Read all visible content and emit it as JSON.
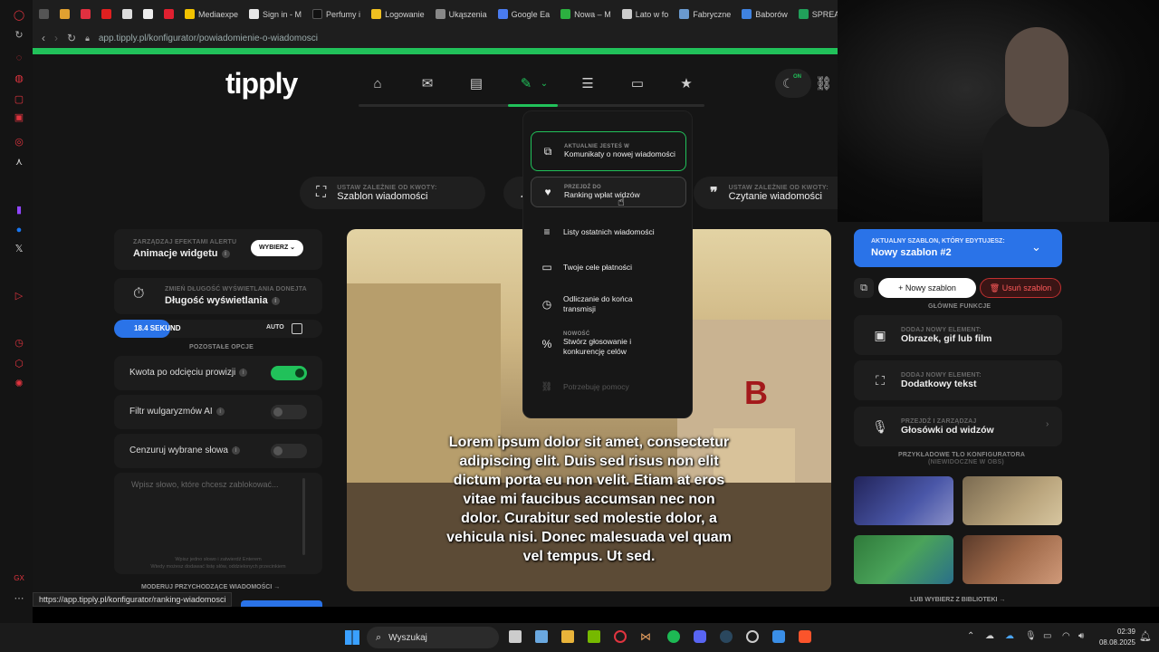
{
  "browser": {
    "bookmarks": [
      {
        "label": "Mediaexpe",
        "color": "#f2c200"
      },
      {
        "label": "Sign in - M",
        "color": "#e8e8e8"
      },
      {
        "label": "Perfumy i",
        "color": "#111111"
      },
      {
        "label": "Logowanie",
        "color": "#f0c020"
      },
      {
        "label": "Ukąszenia",
        "color": "#888888"
      },
      {
        "label": "Google Ea",
        "color": "#4a7cf0"
      },
      {
        "label": "Nowa – M",
        "color": "#2cb040"
      },
      {
        "label": "Lato w fo",
        "color": "#cccccc"
      },
      {
        "label": "Fabryczne",
        "color": "#6a9ad0"
      },
      {
        "label": "Baborów",
        "color": "#3f82e0"
      },
      {
        "label": "SPREA",
        "color": "#21a05a"
      }
    ],
    "url": "app.tipply.pl/konfigurator/powiadomienie-o-wiadomosci",
    "hover_url": "https://app.tipply.pl/konfigurator/ranking-wiadomosci"
  },
  "app": {
    "logo": "tipply",
    "accent": "#21c15a",
    "theme_badge": "ON"
  },
  "top_pills": [
    {
      "small": "USTAW ZALEŻNIE OD KWOTY:",
      "big": "Szablon wiadomości",
      "icon": "expand-icon"
    },
    {
      "small": "USTAW ZALEŻNIE OD KWOTY:",
      "big": "Czytanie wiadomości",
      "icon": "quote-icon"
    }
  ],
  "left_panel": {
    "effects_small": "ZARZĄDZAJ EFEKTAMI ALERTU",
    "effects_label": "Animacje widgetu",
    "effects_button": "WYBIERZ",
    "duration_small": "ZMIEŃ DŁUGOŚĆ WYŚWIETLANIA DONEJTA",
    "duration_label": "Długość wyświetlania",
    "duration_value": "18.4 SEKUND",
    "duration_progress": 0.27,
    "auto_label": "AUTO",
    "other_options": "POZOSTAŁE OPCJE",
    "option1": "Kwota po odcięciu prowizji",
    "option2": "Filtr wulgaryzmów AI",
    "option3": "Cenzuruj wybrane słowa",
    "words_placeholder": "Wpisz słowo, które chcesz zablokować...",
    "words_hint1": "Wpisz jedno słowo i zatwierdź Enterem",
    "words_hint2": "Wtedy możesz dodawać listę słów, oddzielonych przecinkiem",
    "moderate_link": "MODERUJ PRZYCHODZĄCE WIADOMOŚCI"
  },
  "preview": {
    "text": "Lorem ipsum dolor sit amet, consectetur adipiscing elit. Duis sed risus non elit dictum porta eu non velit. Etiam at eros vitae mi faucibus accumsan nec non dolor. Curabitur sed molestie dolor, a vehicula nisi. Donec malesuada vel quam vel tempus. Ut sed.",
    "wall_letter": "B"
  },
  "dropdown": {
    "current_small": "AKTUALNIE JESTEŚ W",
    "current_label": "Komunikaty o nowej wiadomości",
    "goto_small": "PRZEJDŹ DO",
    "goto_label": "Ranking wpłat widzów",
    "item3": "Listy ostatnich wiadomości",
    "item4": "Twoje cele płatności",
    "item5": "Odliczanie do końca transmisji",
    "new_small": "NOWOŚĆ",
    "item6": "Stwórz głosowanie i konkurencję celów",
    "help": "Potrzebuję pomocy"
  },
  "right_panel": {
    "current_small": "AKTUALNY SZABLON, KTÓRY EDYTUJESZ:",
    "current_name": "Nowy szablon #2",
    "new_button": "Nowy szablon",
    "delete_button": "Usuń szablon",
    "main_functions": "GŁÓWNE FUNKCJE",
    "card1_small": "DODAJ NOWY ELEMENT:",
    "card1_label": "Obrazek, gif lub film",
    "card2_small": "DODAJ NOWY ELEMENT:",
    "card2_label": "Dodatkowy tekst",
    "card3_small": "PRZEJDŹ I ZARZĄDZAJ",
    "card3_label": "Głosówki od widzów",
    "bg_title": "PRZYKŁADOWE TŁO KONFIGURATORA",
    "bg_subtitle": "(NIEWIDOCZNE W OBS)",
    "library_link": "LUB WYBIERZ Z BIBLIOTEKI"
  },
  "taskbar": {
    "search": "Wyszukaj",
    "time": "02:39",
    "date": "08.08.2025"
  }
}
